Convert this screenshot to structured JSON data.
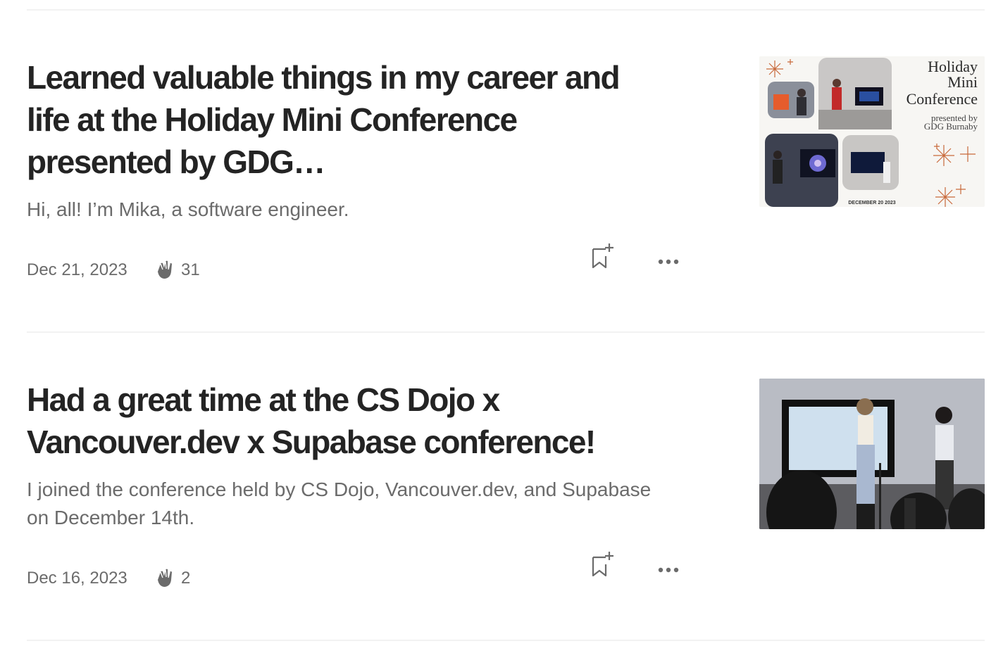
{
  "articles": [
    {
      "title": "Learned valuable things in my career and life at the Holiday Mini Conference presented by GDG…",
      "subtitle": "Hi, all! I’m Mika, a software engineer.",
      "date": "Dec 21, 2023",
      "claps": "31",
      "thumbnail": {
        "icon": "conference-collage-image",
        "heading_line1": "Holiday",
        "heading_line2": "Mini",
        "heading_line3": "Conference",
        "presented_line1": "presented by",
        "presented_line2": "GDG Burnaby",
        "date_text": "DECEMBER 20 2023"
      }
    },
    {
      "title": "Had a great time at the CS Dojo x Vancouver.dev x Supabase conference!",
      "subtitle": "I joined the conference held by CS Dojo, Vancouver.dev, and Supabase on December 14th.",
      "date": "Dec 16, 2023",
      "claps": "2",
      "thumbnail": {
        "icon": "conference-photo-image"
      }
    }
  ],
  "icons": {
    "clap": "clap-icon",
    "bookmark": "bookmark-add-icon",
    "more": "more-dots-icon"
  },
  "colors": {
    "text": "#242424",
    "muted": "#6b6b6b",
    "divider": "#f2f2f2",
    "accent_orange": "#c8693a"
  }
}
